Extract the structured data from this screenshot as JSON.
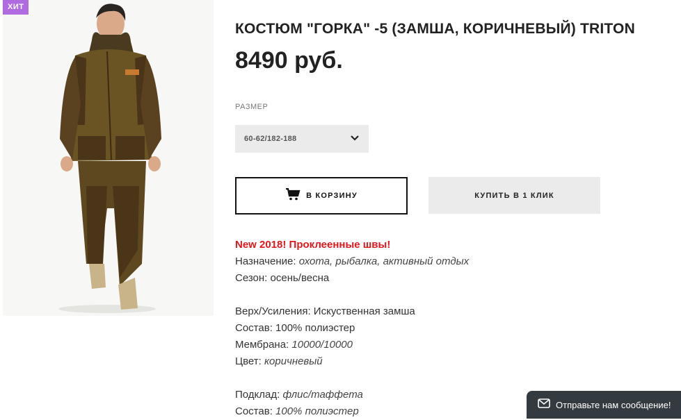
{
  "product": {
    "badge": "ХИТ",
    "title": "КОСТЮМ \"ГОРКА\" -5 (ЗАМША, КОРИЧНЕВЫЙ) TRITON",
    "price": "8490 руб."
  },
  "size": {
    "label": "РАЗМЕР",
    "selected": "60-62/182-188"
  },
  "buttons": {
    "cart": "В КОРЗИНУ",
    "one_click": "КУПИТЬ В 1 КЛИК"
  },
  "description": {
    "highlight": "New 2018! Проклеенные швы!",
    "purpose_label": "Назначение:",
    "purpose_value": "охота, рыбалка, активный отдых",
    "season": "Сезон: осень/весна",
    "top_label": "Верх/Усиления: Искуственная замша",
    "composition1": "Состав: 100% полиэстер",
    "membrane_label": "Мембрана:",
    "membrane_value": "10000/10000",
    "color_label": "Цвет:",
    "color_value": "коричневый",
    "lining_label": "Подклад:",
    "lining_value": "флис/таффета",
    "composition2_label": "Состав:",
    "composition2_value": "100% полиэстер"
  },
  "chat": {
    "label": "Отправьте нам сообщение!"
  },
  "icons": {
    "cart": "cart-icon",
    "chevron": "chevron-down-icon",
    "mail": "mail-icon"
  },
  "colors": {
    "accent_red": "#e3151b",
    "badge": "#b06be0",
    "chat_bg": "#333a40"
  }
}
